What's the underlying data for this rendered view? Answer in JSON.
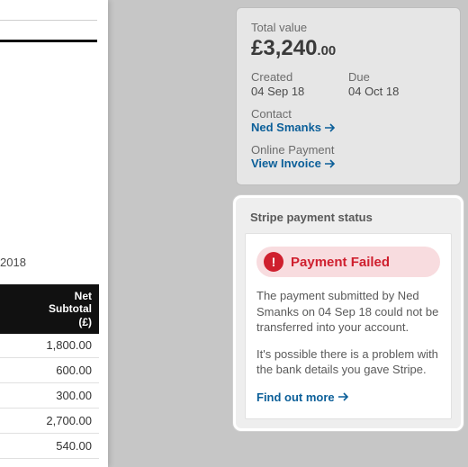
{
  "summary": {
    "totalLabel": "Total value",
    "currencySymbol": "£",
    "totalMain": "3,240",
    "totalDec": ".00",
    "createdLabel": "Created",
    "createdVal": "04 Sep 18",
    "dueLabel": "Due",
    "dueVal": "04 Oct 18",
    "contactLabel": "Contact",
    "contactName": "Ned Smanks",
    "onlinePaymentLabel": "Online Payment",
    "viewInvoice": "View Invoice"
  },
  "stripe": {
    "title": "Stripe payment status",
    "failLabel": "Payment Failed",
    "msg1": "The payment submitted by Ned Smanks on 04 Sep 18 could not be transferred into your account.",
    "msg2": "It's possible there is a problem with the bank details you gave Stripe.",
    "findOutMore": "Find out more"
  },
  "leftPeek": {
    "year": "2018",
    "colHeader1": "Net",
    "colHeader2": "Subtotal",
    "colHeader3": "(£)",
    "rows": [
      "1,800.00",
      "600.00",
      "300.00",
      "2,700.00",
      "540.00"
    ]
  },
  "colors": {
    "link": "#0b5f99",
    "danger": "#cf1f2e"
  }
}
